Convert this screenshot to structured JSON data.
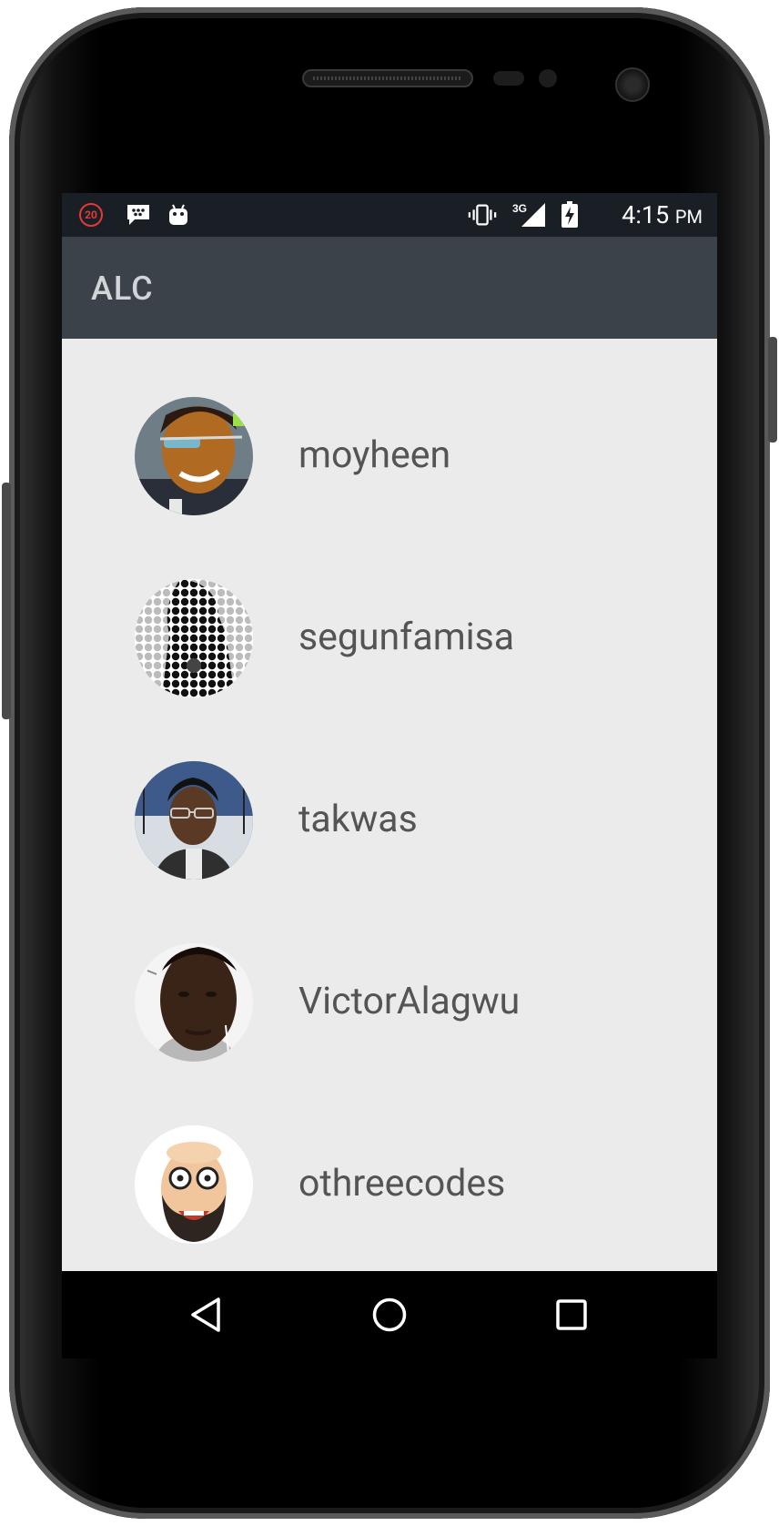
{
  "status_bar": {
    "notification_count": "20",
    "left_icons": [
      "notification-count-icon",
      "bbm-message-icon",
      "android-debug-icon"
    ],
    "right_icons": [
      "vibrate-icon",
      "network-3g-signal-icon",
      "battery-charging-icon"
    ],
    "network_label": "3G",
    "time": "4:15",
    "ampm": "PM"
  },
  "app_bar": {
    "title": "ALC"
  },
  "users": [
    {
      "username": "moyheen",
      "avatar": "photo-woman-with-glasses"
    },
    {
      "username": "segunfamisa",
      "avatar": "halftone-silhouette"
    },
    {
      "username": "takwas",
      "avatar": "photo-man-with-glasses"
    },
    {
      "username": "VictorAlagwu",
      "avatar": "photo-man-with-earphones"
    },
    {
      "username": "othreecodes",
      "avatar": "cartoon-bearded-man"
    }
  ],
  "nav_bar": {
    "buttons": [
      "back-icon",
      "home-icon",
      "recents-icon"
    ]
  },
  "colors": {
    "status_bar": "#1a1f25",
    "app_bar": "#3b4249",
    "app_title": "#d2d5d8",
    "list_background": "#ebebeb",
    "username_text": "#545454"
  }
}
